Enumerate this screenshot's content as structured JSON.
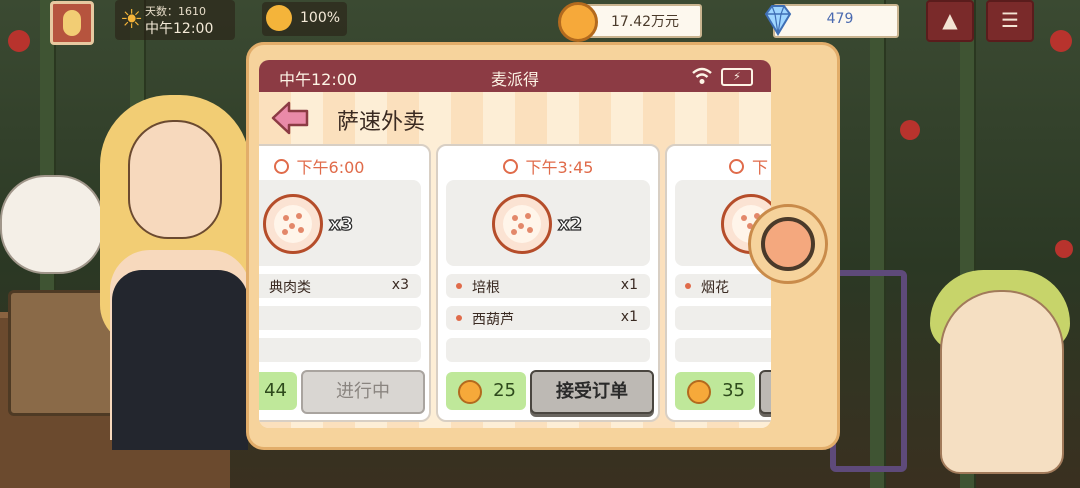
{
  "hud": {
    "day_label": "天数：1610",
    "time_label": "中午12:00",
    "mood_percent": "100%",
    "money": "17.42万元",
    "gems": "479",
    "icons": [
      "avatar",
      "sun-icon",
      "smile-icon",
      "coin-icon",
      "gem-icon",
      "chevron-up-icon",
      "menu-icon"
    ]
  },
  "phone": {
    "status_time": "中午12:00",
    "status_title": "麦派得",
    "app_title": "萨速外卖"
  },
  "orders": [
    {
      "time": "下午6:00",
      "food_qty": "x3",
      "items": [
        {
          "name": "典肉类",
          "qty": "x3"
        }
      ],
      "price": "44",
      "action": "进行中"
    },
    {
      "time": "下午3:45",
      "food_qty": "x2",
      "items": [
        {
          "name": "培根",
          "qty": "x1"
        },
        {
          "name": "西葫芦",
          "qty": "x1"
        }
      ],
      "price": "25",
      "action": "接受订单"
    },
    {
      "time": "下",
      "food_qty": "",
      "items": [
        {
          "name": "烟花",
          "qty": ""
        }
      ],
      "price": "35",
      "action": ""
    }
  ],
  "colors": {
    "status_bar": "#8c3b44",
    "accent_orange": "#e06b4a",
    "price_green": "#bfe89a",
    "phone_body": "#f6d39c"
  }
}
